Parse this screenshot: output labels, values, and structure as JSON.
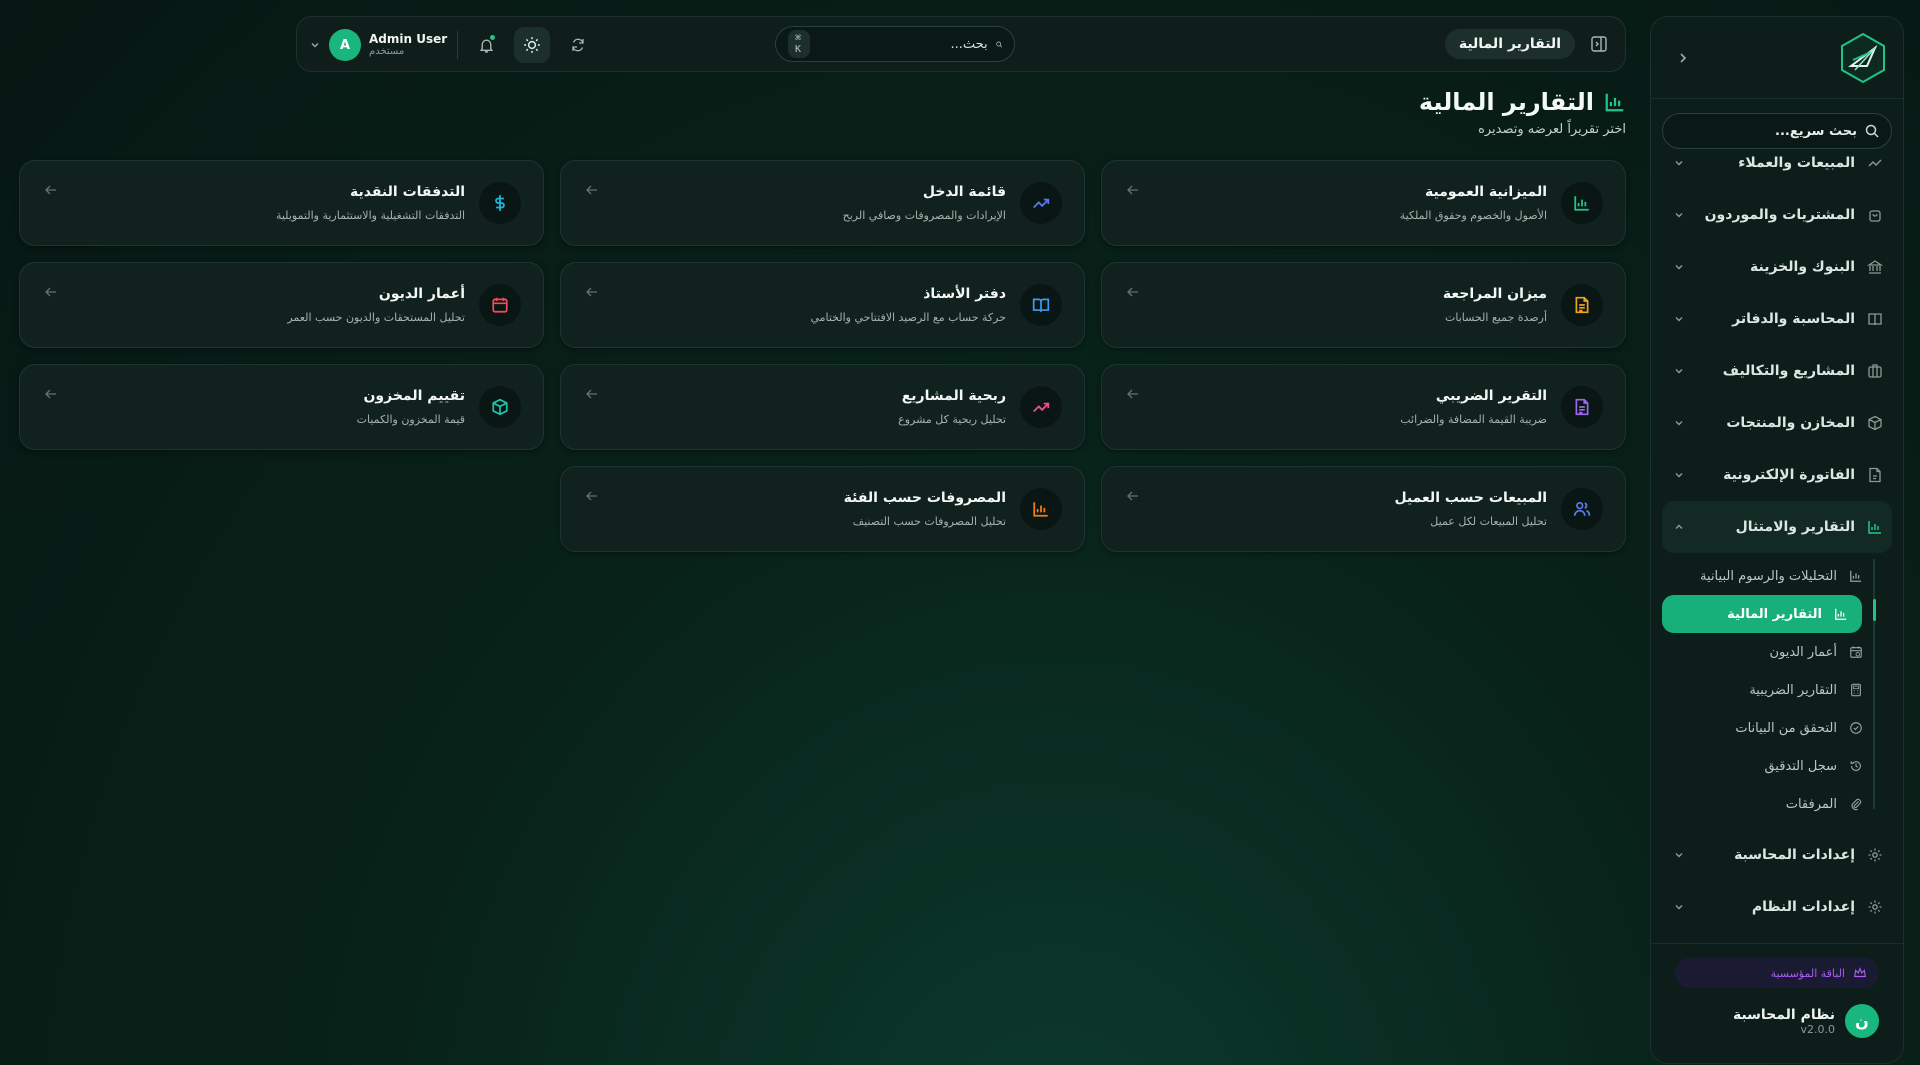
{
  "topbar": {
    "breadcrumb": "التقارير المالية",
    "search_placeholder": "بحث...",
    "shortcut": "⌘ K",
    "user": {
      "initial": "A",
      "name": "Admin User",
      "role": "مستخدم"
    }
  },
  "sidebar": {
    "search_placeholder": "بحث سريع...",
    "items": [
      {
        "label": "المبيعات والعملاء",
        "icon": "trend-icon"
      },
      {
        "label": "المشتريات والموردون",
        "icon": "cart-icon"
      },
      {
        "label": "البنوك والخزينة",
        "icon": "bank-icon"
      },
      {
        "label": "المحاسبة والدفاتر",
        "icon": "book-icon"
      },
      {
        "label": "المشاريع والتكاليف",
        "icon": "briefcase-icon"
      },
      {
        "label": "المخازن والمنتجات",
        "icon": "box-icon"
      },
      {
        "label": "الفاتورة الإلكترونية",
        "icon": "file-icon"
      },
      {
        "label": "التقارير والامتثال",
        "icon": "chart-icon"
      }
    ],
    "sub_items": [
      {
        "label": "التحليلات والرسوم البيانية",
        "icon": "chart-icon"
      },
      {
        "label": "التقارير المالية",
        "icon": "chart-icon"
      },
      {
        "label": "أعمار الديون",
        "icon": "calendar-clock-icon"
      },
      {
        "label": "التقارير الضريبية",
        "icon": "calculator-icon"
      },
      {
        "label": "التحقق من البيانات",
        "icon": "check-circle-icon"
      },
      {
        "label": "سجل التدقيق",
        "icon": "history-icon"
      },
      {
        "label": "المرفقات",
        "icon": "paperclip-icon"
      }
    ],
    "bottom_items": [
      {
        "label": "إعدادات المحاسبة",
        "icon": "gear-icon"
      },
      {
        "label": "إعدادات النظام",
        "icon": "gear-icon"
      }
    ],
    "plan": "الباقة المؤسسية",
    "system": {
      "initial": "ن",
      "name": "نظام المحاسبة",
      "version": "v2.0.0"
    }
  },
  "page": {
    "title": "التقارير المالية",
    "subtitle": "اختر تقريراً لعرضه وتصديره"
  },
  "cards": [
    {
      "title": "الميزانية العمومية",
      "desc": "الأصول والخصوم وحقوق الملكية",
      "icon": "bar-chart-icon",
      "color": "#22c587"
    },
    {
      "title": "قائمة الدخل",
      "desc": "الإيرادات والمصروفات وصافي الربح",
      "icon": "trend-up-icon",
      "color": "#5b74f0"
    },
    {
      "title": "التدفقات النقدية",
      "desc": "التدفقات التشغيلية والاستثمارية والتمويلية",
      "icon": "dollar-icon",
      "color": "#1fb6d6"
    },
    {
      "title": "ميزان المراجعة",
      "desc": "أرصدة جميع الحسابات",
      "icon": "document-icon",
      "color": "#f0a21c"
    },
    {
      "title": "دفتر الأستاذ",
      "desc": "حركة حساب مع الرصيد الافتتاحي والختامي",
      "icon": "open-book-icon",
      "color": "#3b9cf0"
    },
    {
      "title": "أعمار الديون",
      "desc": "تحليل المستحقات والديون حسب العمر",
      "icon": "calendar-icon",
      "color": "#ef4d5e"
    },
    {
      "title": "التقرير الضريبي",
      "desc": "ضريبة القيمة المضافة والضرائب",
      "icon": "receipt-icon",
      "color": "#9a67f0"
    },
    {
      "title": "ربحية المشاريع",
      "desc": "تحليل ربحية كل مشروع",
      "icon": "trend-up-icon",
      "color": "#ec4e96"
    },
    {
      "title": "تقييم المخزون",
      "desc": "قيمة المخزون والكميات",
      "icon": "cube-icon",
      "color": "#1fc4a8"
    },
    {
      "title": "المبيعات حسب العميل",
      "desc": "تحليل المبيعات لكل عميل",
      "icon": "users-icon",
      "color": "#5b7cf0"
    },
    {
      "title": "المصروفات حسب الفئة",
      "desc": "تحليل المصروفات حسب التصنيف",
      "icon": "bar-chart-icon",
      "color": "#f07b1c"
    }
  ],
  "colors": {
    "accent": "#19b67e",
    "premium": "#a45ff0"
  }
}
